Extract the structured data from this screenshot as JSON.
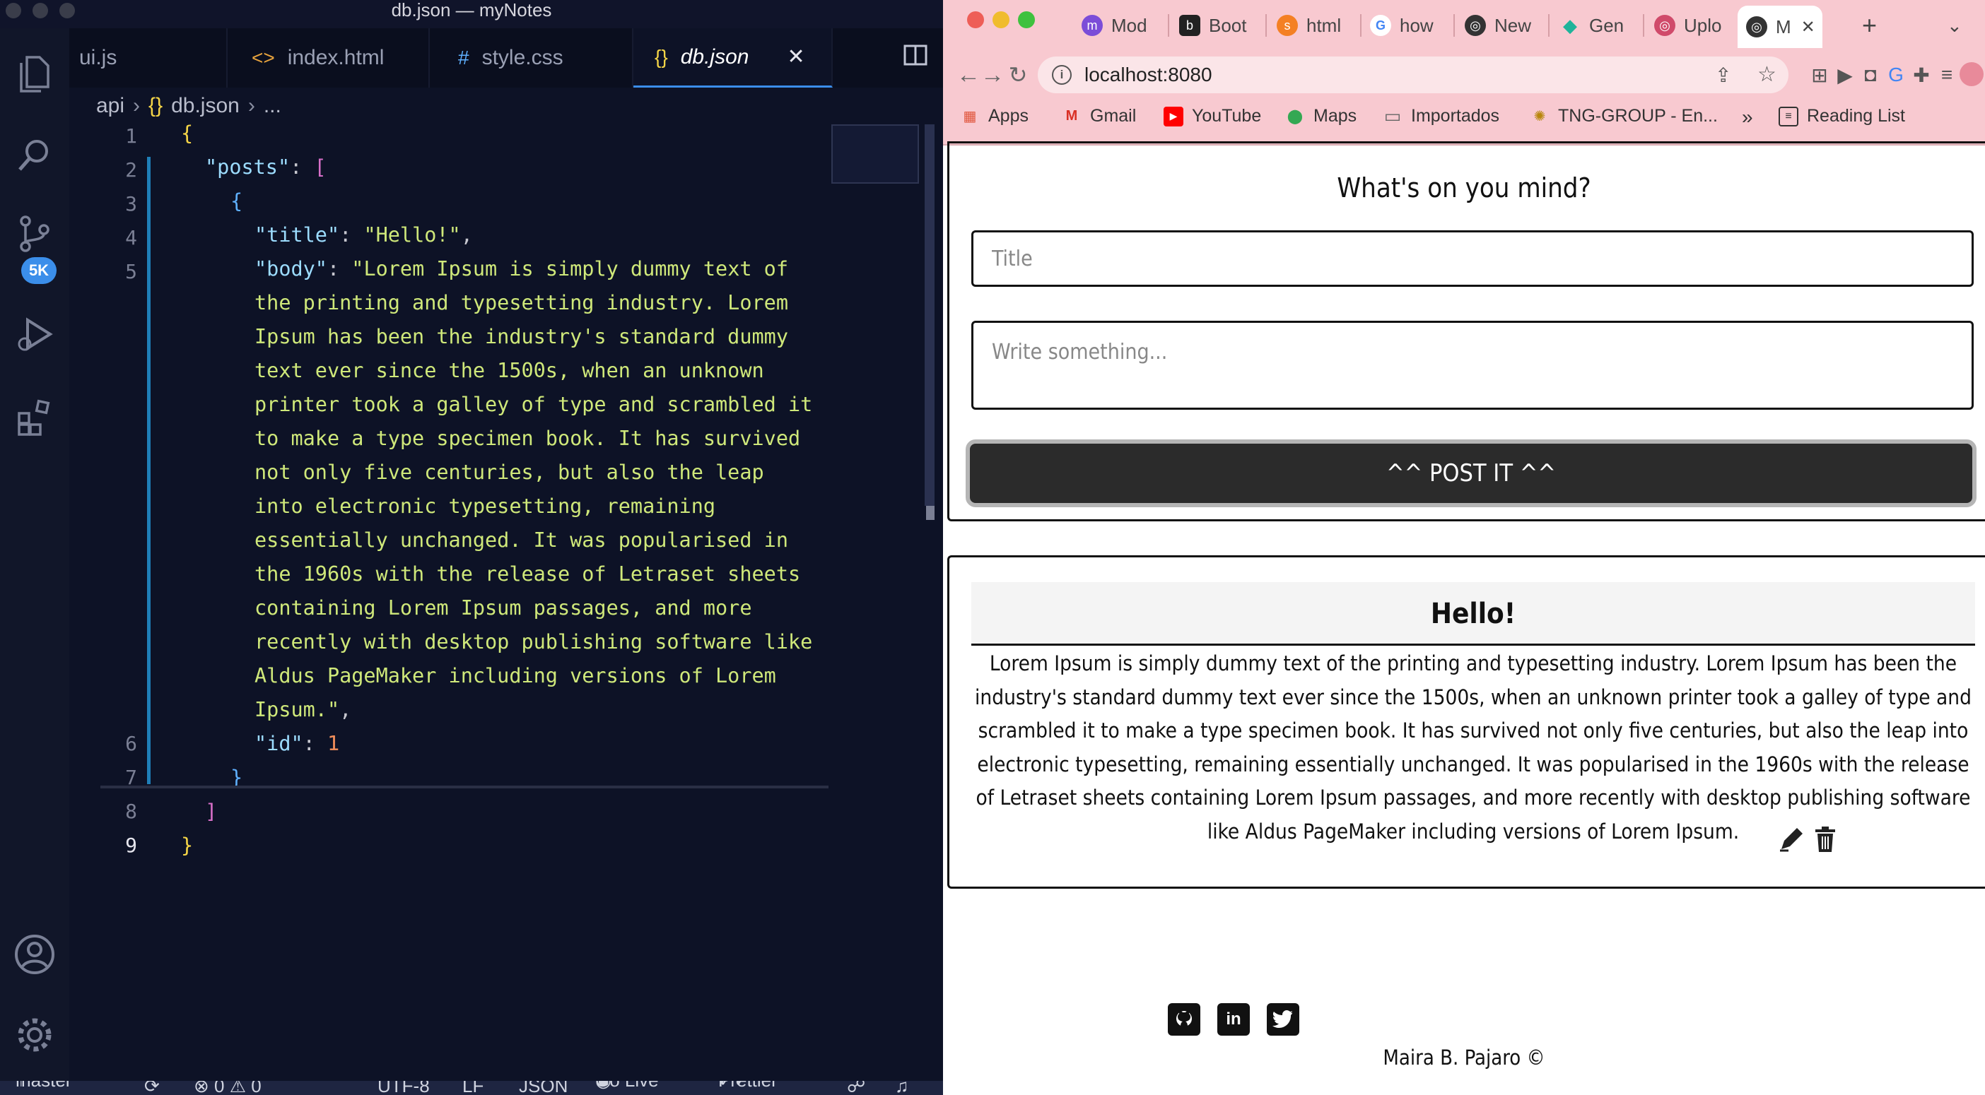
{
  "vscode": {
    "window_title": "db.json — myNotes",
    "activity_badge": "5K",
    "tabs": [
      {
        "icon": "",
        "label": "ui.js"
      },
      {
        "icon": "<>",
        "label": "index.html"
      },
      {
        "icon": "#",
        "label": "style.css"
      },
      {
        "icon": "{}",
        "label": "db.json"
      }
    ],
    "breadcrumb": [
      "api",
      "{}",
      "db.json",
      "..."
    ],
    "line_numbers": [
      "1",
      "2",
      "3",
      "4",
      "5",
      "6",
      "7",
      "8",
      "9"
    ],
    "code": {
      "l1_brace": "{",
      "l2_key": "\"posts\"",
      "l2_colon": ": ",
      "l2_bracket": "[",
      "l3_brace": "{",
      "l4_key": "\"title\"",
      "l4_colon": ": ",
      "l4_value": "\"Hello!\"",
      "l4_comma": ",",
      "l5_key": "\"body\"",
      "l5_colon": ": ",
      "l5_value_lines": [
        "\"Lorem Ipsum is simply dummy text of",
        "the printing and typesetting industry. Lorem",
        "Ipsum has been the industry's standard dummy",
        "text ever since the 1500s, when an unknown",
        "printer took a galley of type and scrambled it",
        "to make a type specimen book. It has survived",
        "not only five centuries, but also the leap",
        "into electronic typesetting, remaining",
        "essentially unchanged. It was popularised in",
        "the 1960s with the release of Letraset sheets",
        "containing Lorem Ipsum passages, and more",
        "recently with desktop publishing software like",
        "Aldus PageMaker including versions of Lorem",
        "Ipsum.\""
      ],
      "l5_comma": ",",
      "l6_key": "\"id\"",
      "l6_colon": ": ",
      "l6_value": "1",
      "l7_brace": "}",
      "l8_bracket": "]",
      "l9_brace": "}"
    },
    "status": {
      "branch": "master*",
      "problems": "⊗ 0 ⚠ 0",
      "encoding": "UTF-8",
      "eol": "LF",
      "language": "JSON",
      "go_live": "Go Live",
      "prettier": "Prettier"
    }
  },
  "browser": {
    "tabs": [
      {
        "label": "Mod",
        "fav": "m",
        "color": "#7b4dd8"
      },
      {
        "label": "Boot",
        "fav": "b",
        "color": "#222222"
      },
      {
        "label": "html",
        "fav": "s",
        "color": "#f48024"
      },
      {
        "label": "how",
        "fav": "G",
        "color": "#4285f4"
      },
      {
        "label": "New",
        "fav": "◎",
        "color": "#333333"
      },
      {
        "label": "Gen",
        "fav": "◆",
        "color": "#1fb39a"
      },
      {
        "label": "Uplo",
        "fav": "◎",
        "color": "#d04a6a"
      },
      {
        "label": "M",
        "fav": "◎",
        "color": "#333333"
      }
    ],
    "url": "localhost:8080",
    "bookmarks": [
      {
        "label": "Apps",
        "icon": "▦",
        "color": "#e0543a"
      },
      {
        "label": "Gmail",
        "icon": "M",
        "color": "#d93025"
      },
      {
        "label": "YouTube",
        "icon": "▶",
        "color": "#ff0000"
      },
      {
        "label": "Maps",
        "icon": "⬤",
        "color": "#34a853"
      },
      {
        "label": "Importados",
        "icon": "▭",
        "color": "#666666"
      },
      {
        "label": "TNG-GROUP - En...",
        "icon": "✺",
        "color": "#b8860b"
      }
    ],
    "bookmarks_more": "»",
    "reading_list": "Reading List"
  },
  "page": {
    "form_title": "What's on you mind?",
    "title_placeholder": "Title",
    "body_placeholder": "Write something...",
    "post_button": "^^ POST IT ^^",
    "post": {
      "title": "Hello!",
      "body": "Lorem Ipsum is simply dummy text of the printing and typesetting industry. Lorem Ipsum has been the industry's standard dummy text ever since the 1500s, when an unknown printer took a galley of type and scrambled it to make a type specimen book. It has survived not only five centuries, but also the leap into electronic typesetting, remaining essentially unchanged. It was popularised in the 1960s with the release of Letraset sheets containing Lorem Ipsum passages, and more recently with desktop publishing software like Aldus PageMaker including versions of Lorem Ipsum."
    },
    "footer_credit": "Maira B. Pajaro ©"
  }
}
